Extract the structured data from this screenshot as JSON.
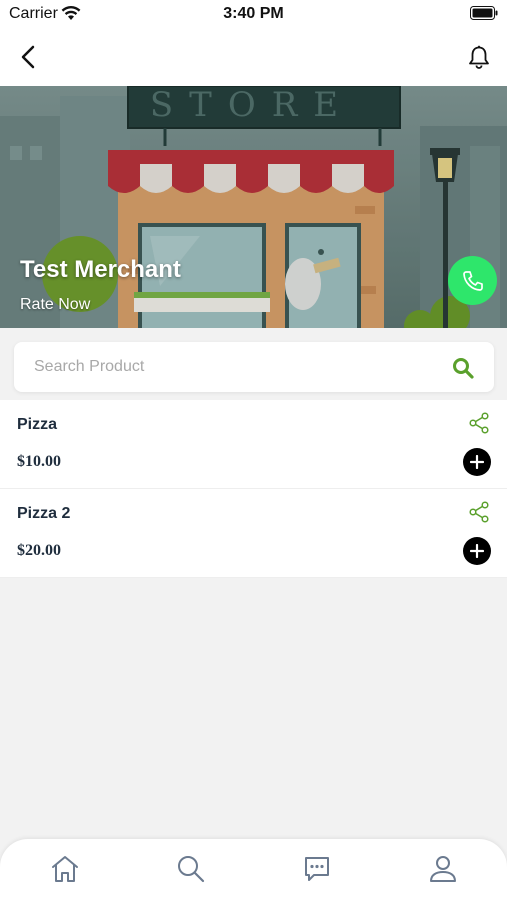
{
  "status_bar": {
    "carrier": "Carrier",
    "time": "3:40 PM"
  },
  "merchant": {
    "name": "Test Merchant",
    "rate_label": "Rate Now",
    "store_sign": "STORE"
  },
  "search": {
    "placeholder": "Search Product",
    "value": ""
  },
  "products": [
    {
      "name": "Pizza",
      "price": "$10.00"
    },
    {
      "name": "Pizza 2",
      "price": "$20.00"
    }
  ],
  "tabs": [
    {
      "icon": "home-icon"
    },
    {
      "icon": "search-icon"
    },
    {
      "icon": "chat-icon"
    },
    {
      "icon": "profile-icon"
    }
  ],
  "colors": {
    "accent_green": "#5aa02c",
    "call_green": "#2ee66b",
    "text_dark": "#1f2d3d",
    "icon_gray": "#6b7a8f"
  }
}
